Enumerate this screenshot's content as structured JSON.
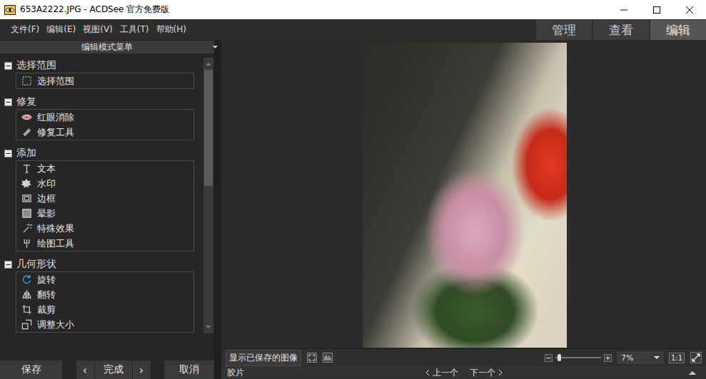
{
  "window": {
    "title": "653A2222.JPG - ACDSee 官方免费版"
  },
  "menu": [
    "文件(F)",
    "编辑(E)",
    "视图(V)",
    "工具(T)",
    "帮助(H)"
  ],
  "mode_tabs": [
    {
      "label": "管理",
      "selected": false
    },
    {
      "label": "查看",
      "selected": false
    },
    {
      "label": "编辑",
      "selected": true
    }
  ],
  "panel": {
    "title": "编辑模式菜单",
    "groups": [
      {
        "label": "选择范围",
        "expanded": true,
        "items": [
          "选择范围"
        ]
      },
      {
        "label": "修复",
        "expanded": true,
        "items": [
          "红眼消除",
          "修复工具"
        ]
      },
      {
        "label": "添加",
        "expanded": true,
        "items": [
          "文本",
          "水印",
          "边框",
          "晕影",
          "特殊效果",
          "绘图工具"
        ]
      },
      {
        "label": "几何形状",
        "expanded": true,
        "items": [
          "旋转",
          "翻转",
          "裁剪",
          "调整大小"
        ]
      }
    ],
    "scrollbar": {
      "thumb_share": 0.46,
      "position": 0
    }
  },
  "panel_buttons": {
    "save": "保存",
    "prev": "‹",
    "done": "完成",
    "next": "›",
    "cancel": "取消"
  },
  "viewer": {
    "show_saved": "显示已保存的图像",
    "zoom": {
      "level": 0.06,
      "value": "7%"
    },
    "actual_size": "1:1"
  },
  "filmstrip": {
    "label": "胶片",
    "prev": "上一个",
    "next": "下一个"
  }
}
